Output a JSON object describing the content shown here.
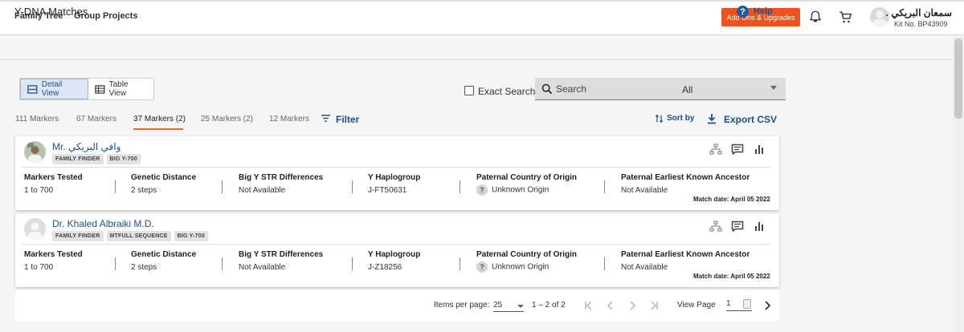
{
  "nav": {
    "family_tree": "Family Tree",
    "group_projects": "Group Projects",
    "addons_button": "Add Ons & Upgrades",
    "user_name": "سمعان البريكي .",
    "kit_no": "Kit No. BP43909"
  },
  "page": {
    "title": "Y-DNA Matches",
    "help": "Help"
  },
  "view_toggle": {
    "detail": "Detail View",
    "table": "Table View",
    "active": "detail"
  },
  "search": {
    "exact_label": "Exact Search",
    "exact_checked": false,
    "placeholder": "Search",
    "scope_value": "All"
  },
  "tabs": [
    {
      "label": "111 Markers",
      "active": false
    },
    {
      "label": "67 Markers",
      "active": false
    },
    {
      "label": "37 Markers (2)",
      "active": true
    },
    {
      "label": "25 Markers (2)",
      "active": false
    },
    {
      "label": "12 Markers",
      "active": false
    }
  ],
  "actions": {
    "filter": "Filter",
    "sort_by": "Sort by",
    "export_csv": "Export CSV"
  },
  "columns": {
    "markers_tested": "Markers Tested",
    "genetic_distance": "Genetic Distance",
    "big_y_str": "Big Y STR Differences",
    "haplogroup": "Y Haplogroup",
    "country": "Paternal Country of Origin",
    "ancestor": "Paternal Earliest Known Ancestor"
  },
  "matches": [
    {
      "name": "Mr. وافي البريكي",
      "badges": [
        "FAMILY FINDER",
        "BIG Y-700"
      ],
      "markers_tested": "1 to 700",
      "genetic_distance": "2 steps",
      "big_y_str": "Not Available",
      "haplogroup": "J-FT50631",
      "country": "Unknown Origin",
      "ancestor": "Not Available",
      "match_date": "Match date: April 05 2022"
    },
    {
      "name": "Dr. Khaled Albraiki M.D.",
      "badges": [
        "FAMILY FINDER",
        "MTFULL SEQUENCE",
        "BIG Y-700"
      ],
      "markers_tested": "1 to 700",
      "genetic_distance": "2 steps",
      "big_y_str": "Not Available",
      "haplogroup": "J-Z18256",
      "country": "Unknown Origin",
      "ancestor": "Not Available",
      "match_date": "Match date: April 05 2022"
    }
  ],
  "pagination": {
    "items_per_page_label": "Items per page:",
    "items_per_page": "25",
    "range": "1 – 2 of 2",
    "view_page_label": "View Page",
    "page": "1"
  },
  "colors": {
    "accent": "#1d4f8e",
    "addons": "#f0521f",
    "tab_underline": "#e8663b"
  },
  "icons": [
    "bell-icon",
    "cart-icon",
    "help-icon",
    "search-icon",
    "filter-icon",
    "sort-icon",
    "download-icon",
    "tree-icon",
    "message-icon",
    "chart-icon",
    "first-page-icon",
    "prev-page-icon",
    "next-page-icon",
    "last-page-icon"
  ]
}
